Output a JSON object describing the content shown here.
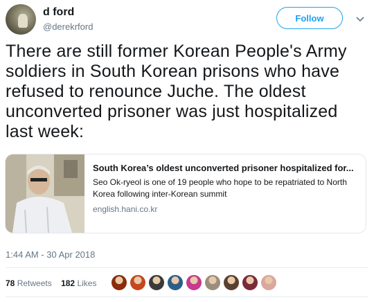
{
  "user": {
    "name": "d ford",
    "handle": "@derekrford",
    "follow_label": "Follow"
  },
  "tweet": {
    "text": "There are still former Korean People's Army soldiers in South Korean prisons who have refused to renounce Juche. The oldest unconverted prisoner was just hospitalized last week:",
    "timestamp": "1:44 AM - 30 Apr 2018"
  },
  "card": {
    "title": "South Korea’s oldest unconverted prisoner hospitalized for...",
    "description": "Seo Ok-ryeol is one of 19 people who hope to be repatriated to North Korea following inter-Korean summit",
    "domain": "english.hani.co.kr"
  },
  "stats": {
    "retweets_count": "78",
    "retweets_label": "Retweets",
    "likes_count": "182",
    "likes_label": "Likes"
  },
  "likers": [
    {
      "color": "#8a2d0a"
    },
    {
      "color": "#c4471f"
    },
    {
      "color": "#3a3a3a"
    },
    {
      "color": "#2b5f8a"
    },
    {
      "color": "#c73a8e"
    },
    {
      "color": "#9a8f7f"
    },
    {
      "color": "#5a4030"
    },
    {
      "color": "#7a2a3a"
    },
    {
      "color": "#d9a7a0"
    }
  ]
}
